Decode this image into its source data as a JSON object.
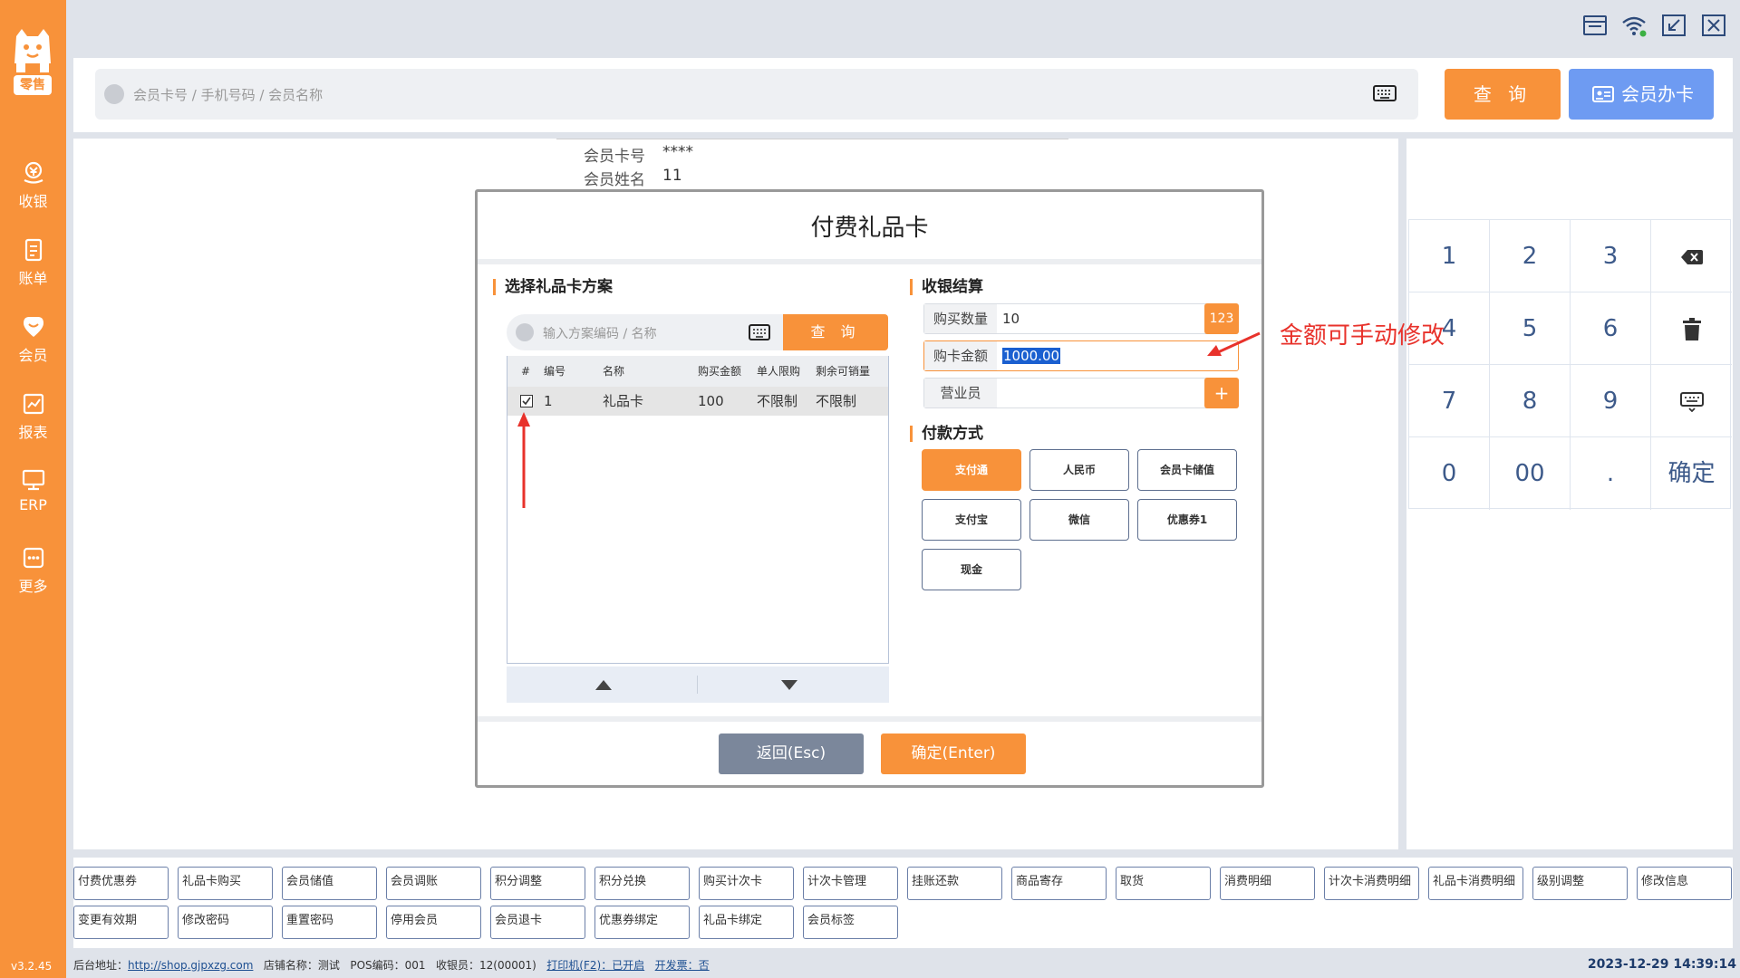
{
  "sidebar": {
    "logo_text": "零售",
    "items": [
      {
        "label": "收银",
        "icon": "cashier-icon"
      },
      {
        "label": "账单",
        "icon": "bill-icon"
      },
      {
        "label": "会员",
        "icon": "member-icon"
      },
      {
        "label": "报表",
        "icon": "report-icon"
      },
      {
        "label": "ERP",
        "icon": "erp-icon"
      },
      {
        "label": "更多",
        "icon": "more-icon"
      }
    ],
    "version": "v3.2.45"
  },
  "topbar": {
    "search_placeholder": "会员卡号 / 手机号码 / 会员名称",
    "query_label": "查 询",
    "card_label": "会员办卡"
  },
  "member": {
    "card_no_label": "会员卡号",
    "card_no": "****",
    "name_label": "会员姓名",
    "name": "11"
  },
  "modal": {
    "title": "付费礼品卡",
    "left_section": "选择礼品卡方案",
    "search_placeholder": "输入方案编码 / 名称",
    "query_label": "查 询",
    "table": {
      "headers": [
        "#",
        "编号",
        "名称",
        "购买金额",
        "单人限购",
        "剩余可销量"
      ],
      "rows": [
        {
          "checked": true,
          "id": "1",
          "name": "礼品卡",
          "amount": "100",
          "limit": "不限制",
          "remaining": "不限制"
        }
      ]
    },
    "right_section": "收银结算",
    "qty_label": "购买数量",
    "qty_value": "10",
    "qty_badge": "123",
    "amount_label": "购卡金额",
    "amount_value": "1000.00",
    "clerk_label": "营业员",
    "clerk_value": "",
    "clerk_add": "+",
    "pay_section": "付款方式",
    "pay_methods": [
      "支付通",
      "人民币",
      "会员卡储值",
      "支付宝",
      "微信",
      "优惠券1",
      "现金"
    ],
    "active_pay": "支付通",
    "back_label": "返回(Esc)",
    "ok_label": "确定(Enter)"
  },
  "annotation": "金额可手动修改",
  "numpad": {
    "keys": [
      "1",
      "2",
      "3",
      "",
      "4",
      "5",
      "6",
      "",
      "7",
      "8",
      "9",
      "",
      "0",
      "00",
      ".",
      "确定"
    ]
  },
  "functions": {
    "row1": [
      "付费优惠券",
      "礼品卡购买",
      "会员储值",
      "会员调账",
      "积分调整",
      "积分兑换",
      "购买计次卡",
      "计次卡管理",
      "挂账还款",
      "商品寄存",
      "取货",
      "消费明细",
      "计次卡消费明细",
      "礼品卡消费明细",
      "级别调整",
      "修改信息"
    ],
    "row2": [
      "变更有效期",
      "修改密码",
      "重置密码",
      "停用会员",
      "会员退卡",
      "优惠券绑定",
      "礼品卡绑定",
      "会员标签"
    ]
  },
  "status": {
    "backend_label": "后台地址：",
    "backend_url": "http://shop.gjpxzg.com",
    "store": "店铺名称：测试",
    "pos": "POS编码：001",
    "cashier": "收银员：12(00001)",
    "printer": "打印机(F2)：已开启",
    "invoice": "开发票：否",
    "datetime": "2023-12-29 14:39:14"
  },
  "colors": {
    "accent": "#f8923a",
    "blue": "#6e9bf2",
    "annotation": "#e8322b"
  }
}
